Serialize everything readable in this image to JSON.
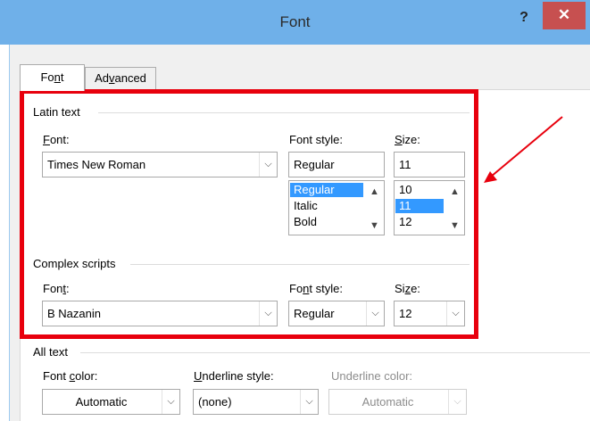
{
  "window": {
    "title": "Font",
    "help_icon": "?",
    "close_icon": "✕"
  },
  "tabs": [
    {
      "label_pre": "Fo",
      "label_key": "n",
      "label_post": "t",
      "active": true
    },
    {
      "label_pre": "Ad",
      "label_key": "v",
      "label_post": "anced",
      "active": false
    }
  ],
  "latin": {
    "group_label": "Latin text",
    "font_label_pre": "",
    "font_label_key": "F",
    "font_label_post": "ont:",
    "font_value": "Times New Roman",
    "style_label": "Font style:",
    "style_value": "Regular",
    "style_list": [
      "Regular",
      "Italic",
      "Bold"
    ],
    "style_selected": "Regular",
    "size_label_pre": "",
    "size_label_key": "S",
    "size_label_post": "ize:",
    "size_value": "11",
    "size_list": [
      "10",
      "11",
      "12"
    ],
    "size_selected": "11"
  },
  "complex": {
    "group_label": "Complex scripts",
    "font_label_pre": "Fon",
    "font_label_key": "t",
    "font_label_post": ":",
    "font_value": "B Nazanin",
    "style_label_pre": "Fo",
    "style_label_key": "n",
    "style_label_post": "t style:",
    "style_value": "Regular",
    "size_label_pre": "Si",
    "size_label_key": "z",
    "size_label_post": "e:",
    "size_value": "12"
  },
  "alltext": {
    "group_label": "All text",
    "color_label_pre": "Font ",
    "color_label_key": "c",
    "color_label_post": "olor:",
    "color_value": "Automatic",
    "underline_label_pre": "",
    "underline_label_key": "U",
    "underline_label_post": "nderline style:",
    "underline_value": "(none)",
    "underline_color_label": "Underline color:",
    "underline_color_value": "Automatic"
  },
  "icons": {
    "dropdown": "chevron-down-icon",
    "scroll_up": "chevron-up-icon",
    "scroll_down": "chevron-down-icon",
    "arrow": "red-arrow-annotation"
  },
  "colors": {
    "titlebar": "#6fb0e9",
    "close": "#c75050",
    "selection": "#3399ff",
    "annotation": "#e8000d"
  }
}
